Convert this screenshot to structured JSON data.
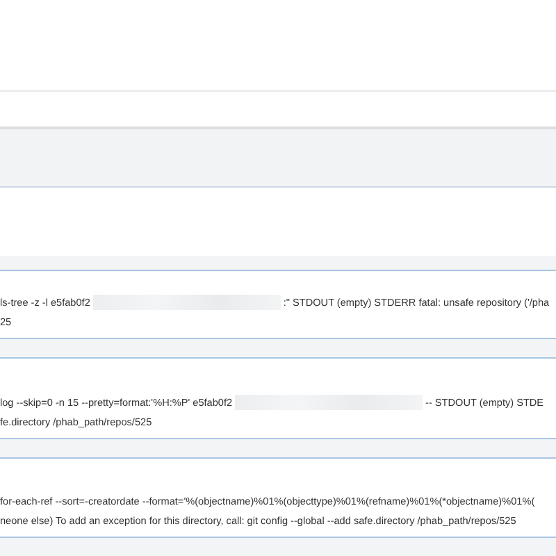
{
  "cards": [
    {
      "lines": [
        [
          {
            "kind": "text",
            "text": "ls-tree -z -l e5fab0f2"
          },
          {
            "kind": "redacted"
          },
          {
            "kind": "text",
            "text": ":\" STDOUT (empty) STDERR fatal: unsafe repository ('/pha"
          }
        ],
        [
          {
            "kind": "text",
            "text": "25"
          }
        ]
      ]
    },
    {
      "lines": [
        [
          {
            "kind": "text",
            "text": "log --skip=0 -n 15 --pretty=format:'%H:%P' e5fab0f2"
          },
          {
            "kind": "redacted"
          },
          {
            "kind": "text",
            "text": "-- STDOUT (empty) STDE"
          }
        ],
        [
          {
            "kind": "text",
            "text": "fe.directory /phab_path/repos/525"
          }
        ]
      ]
    },
    {
      "lines": [
        [
          {
            "kind": "text",
            "text": "for-each-ref --sort=-creatordate --format='%(objectname)%01%(objecttype)%01%(refname)%01%(*objectname)%01%("
          }
        ],
        [
          {
            "kind": "text",
            "text": "neone else) To add an exception for this directory, call: git config --global --add safe.directory /phab_path/repos/525"
          }
        ]
      ]
    }
  ]
}
